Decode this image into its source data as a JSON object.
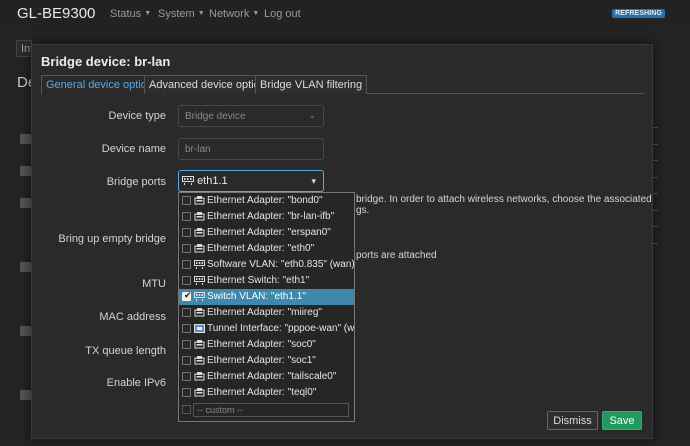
{
  "header": {
    "brand": "GL-BE9300",
    "nav": [
      {
        "label": "Status",
        "has_menu": true
      },
      {
        "label": "System",
        "has_menu": true
      },
      {
        "label": "Network",
        "has_menu": true
      },
      {
        "label": "Log out",
        "has_menu": false
      }
    ],
    "badge": "REFRESHING"
  },
  "background": {
    "tab_fragment": "Inte",
    "title_fragment": "De"
  },
  "modal": {
    "title": "Bridge device: br-lan",
    "tabs": [
      {
        "label": "General device options",
        "active": true
      },
      {
        "label": "Advanced device options",
        "active": false
      },
      {
        "label": "Bridge VLAN filtering",
        "active": false
      }
    ],
    "fields": {
      "device_type": {
        "label": "Device type",
        "value": "Bridge device"
      },
      "device_name": {
        "label": "Device name",
        "value": "br-lan"
      },
      "bridge_ports": {
        "label": "Bridge ports",
        "value": "eth1.1"
      },
      "bring_up_empty": {
        "label": "Bring up empty bridge"
      },
      "mtu": {
        "label": "MTU"
      },
      "mac": {
        "label": "MAC address"
      },
      "txq": {
        "label": "TX queue length"
      },
      "ipv6": {
        "label": "Enable IPv6"
      }
    },
    "help": {
      "ports_line1": "bridge. In order to attach wireless networks, choose the associated",
      "ports_line2": "gs.",
      "empty_bridge": "ports are attached"
    },
    "dropdown": {
      "options": [
        {
          "text": "Ethernet Adapter: \"bond0\"",
          "icon": "ethernet-port-icon",
          "checked": false
        },
        {
          "text": "Ethernet Adapter: \"br-lan-ifb\"",
          "icon": "ethernet-port-icon",
          "checked": false
        },
        {
          "text": "Ethernet Adapter: \"erspan0\"",
          "icon": "ethernet-port-icon",
          "checked": false
        },
        {
          "text": "Ethernet Adapter: \"eth0\"",
          "icon": "ethernet-port-icon",
          "checked": false
        },
        {
          "text": "Software VLAN: \"eth0.835\" (wan)",
          "icon": "switch-icon",
          "checked": false
        },
        {
          "text": "Ethernet Switch: \"eth1\"",
          "icon": "switch-icon",
          "checked": false
        },
        {
          "text": "Switch VLAN: \"eth1.1\"",
          "icon": "switch-icon",
          "checked": true
        },
        {
          "text": "Ethernet Adapter: \"miireg\"",
          "icon": "ethernet-port-icon",
          "checked": false
        },
        {
          "text": "Tunnel Interface: \"pppoe-wan\" (wan)",
          "icon": "tunnel-icon",
          "checked": false
        },
        {
          "text": "Ethernet Adapter: \"soc0\"",
          "icon": "ethernet-port-icon",
          "checked": false
        },
        {
          "text": "Ethernet Adapter: \"soc1\"",
          "icon": "ethernet-port-icon",
          "checked": false
        },
        {
          "text": "Ethernet Adapter: \"tailscale0\"",
          "icon": "ethernet-port-icon",
          "checked": false
        },
        {
          "text": "Ethernet Adapter: \"teql0\"",
          "icon": "ethernet-port-icon",
          "checked": false
        }
      ],
      "custom_placeholder": "-- custom --"
    },
    "buttons": {
      "dismiss": "Dismiss",
      "save": "Save"
    }
  },
  "colors": {
    "accent": "#5aa8e4",
    "selected_row": "#3e87ad",
    "save": "#1f9a5b",
    "badge": "#2a6ea8"
  }
}
